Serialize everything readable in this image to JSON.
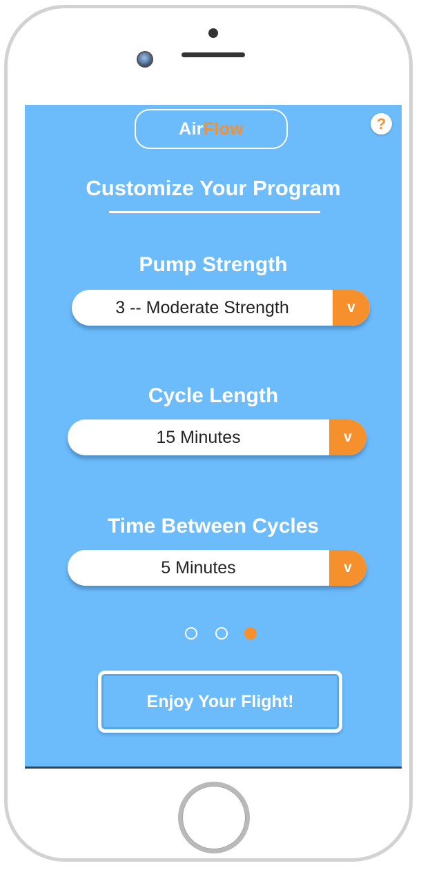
{
  "brand": {
    "part1": "Air",
    "part2": "Flow"
  },
  "help": {
    "label": "?"
  },
  "page": {
    "title": "Customize Your Program"
  },
  "fields": [
    {
      "label": "Pump Strength",
      "value": "3 -- Moderate Strength",
      "arrow": "v"
    },
    {
      "label": "Cycle Length",
      "value": "15 Minutes",
      "arrow": "v"
    },
    {
      "label": "Time Between Cycles",
      "value": "5 Minutes",
      "arrow": "v"
    }
  ],
  "pagination": {
    "total": 3,
    "active_index": 3
  },
  "cta": {
    "label": "Enjoy Your Flight!"
  },
  "colors": {
    "screen_background": "#6cbcfb",
    "accent": "#f5902d",
    "text_light": "#ffffff"
  },
  "icons": {
    "help": "question-mark-icon",
    "dropdown": "chevron-down-icon"
  }
}
